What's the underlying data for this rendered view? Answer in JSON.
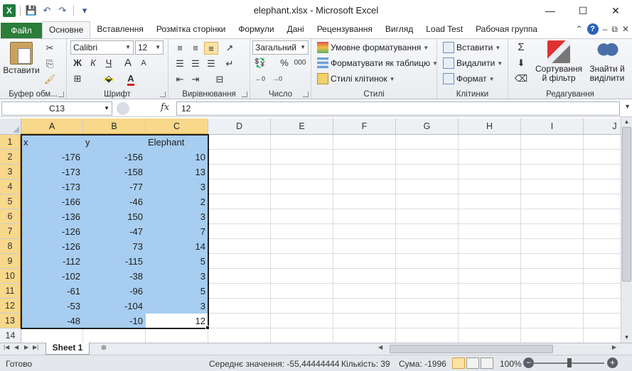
{
  "window": {
    "title": "elephant.xlsx - Microsoft Excel",
    "app_icon_letter": "X",
    "minimize_icon": "—",
    "maximize_icon": "☐",
    "close_icon": "✕"
  },
  "quick_access": {
    "save_icon": "💾",
    "undo_icon": "↶",
    "redo_icon": "↷",
    "customize_icon": "▾"
  },
  "ribbon_tabs": [
    {
      "label": "Файл"
    },
    {
      "label": "Основне"
    },
    {
      "label": "Вставлення"
    },
    {
      "label": "Розмітка сторінки"
    },
    {
      "label": "Формули"
    },
    {
      "label": "Дані"
    },
    {
      "label": "Рецензування"
    },
    {
      "label": "Вигляд"
    },
    {
      "label": "Load Test"
    },
    {
      "label": "Рабочая группа"
    }
  ],
  "ribbon": {
    "clipboard": {
      "label": "Буфер обм...",
      "paste": "Вставити"
    },
    "font": {
      "label": "Шрифт",
      "family": "Calibri",
      "size": "12",
      "bold": "Ж",
      "italic": "К",
      "underline": "Ч",
      "grow": "A",
      "shrink": "A"
    },
    "alignment": {
      "label": "Вирівнювання"
    },
    "number": {
      "label": "Число",
      "format": "Загальний",
      "percent": "%",
      "thousands": "000"
    },
    "styles": {
      "label": "Стилі",
      "conditional": "Умовне форматування",
      "as_table": "Форматувати як таблицю",
      "cell_styles": "Стилі клітинок"
    },
    "cells": {
      "label": "Клітинки",
      "insert": "Вставити",
      "delete": "Видалити",
      "format": "Формат"
    },
    "editing": {
      "label": "Редагування",
      "autosum": "Σ",
      "sort": "Сортування й фільтр",
      "find": "Знайти й виділити"
    }
  },
  "formula_bar": {
    "name_box": "C13",
    "fx": "fx",
    "value": "12"
  },
  "columns": [
    "A",
    "B",
    "C",
    "D",
    "E",
    "F",
    "G",
    "H",
    "I",
    "J"
  ],
  "rows": [
    {
      "n": "1",
      "a": "x",
      "b": "y",
      "c": "Elephant"
    },
    {
      "n": "2",
      "a": "-176",
      "b": "-156",
      "c": "10"
    },
    {
      "n": "3",
      "a": "-173",
      "b": "-158",
      "c": "13"
    },
    {
      "n": "4",
      "a": "-173",
      "b": "-77",
      "c": "3"
    },
    {
      "n": "5",
      "a": "-166",
      "b": "-46",
      "c": "2"
    },
    {
      "n": "6",
      "a": "-136",
      "b": "150",
      "c": "3"
    },
    {
      "n": "7",
      "a": "-126",
      "b": "-47",
      "c": "7"
    },
    {
      "n": "8",
      "a": "-126",
      "b": "73",
      "c": "14"
    },
    {
      "n": "9",
      "a": "-112",
      "b": "-115",
      "c": "5"
    },
    {
      "n": "10",
      "a": "-102",
      "b": "-38",
      "c": "3"
    },
    {
      "n": "11",
      "a": "-61",
      "b": "-96",
      "c": "5"
    },
    {
      "n": "12",
      "a": "-53",
      "b": "-104",
      "c": "3"
    },
    {
      "n": "13",
      "a": "-48",
      "b": "-10",
      "c": "12"
    },
    {
      "n": "14",
      "a": "",
      "b": "",
      "c": ""
    }
  ],
  "sheet_tabs": [
    {
      "label": "Sheet 1"
    }
  ],
  "status": {
    "ready": "Готово",
    "average": "Середнє значення: -55,44444444",
    "count": "Кількість: 39",
    "sum": "Сума: -1996",
    "zoom": "100%"
  },
  "colors": {
    "file_tab": "#2b7d3a",
    "selection": "#a7cdf0",
    "header_selected": "#f8d88a"
  }
}
